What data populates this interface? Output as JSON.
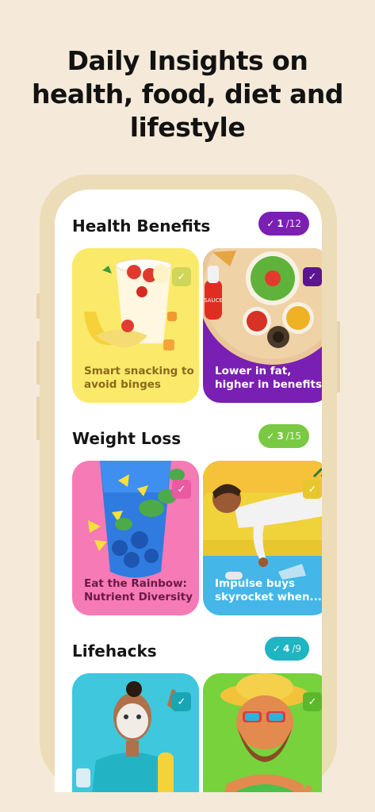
{
  "headline": {
    "line1": "Daily Insights on",
    "line2": "health, food, diet and",
    "line3": "lifestyle"
  },
  "sections": [
    {
      "title": "Health Benefits",
      "badge": {
        "done": "1",
        "total": "/12",
        "color": "#7a1fb3"
      },
      "cards": [
        {
          "caption": "Smart snacking to avoid binges",
          "bg": "#fbe96a",
          "caption_color": "#8a6a1a",
          "icon": "banana-yogurt-cup-image"
        },
        {
          "caption": "Lower in fat, higher in benefits",
          "bg": "#7a1fb3",
          "caption_color": "#ffffff",
          "icon": "food-platter-image",
          "sauce_label": "SAUCE"
        }
      ]
    },
    {
      "title": "Weight Loss",
      "badge": {
        "done": "3",
        "total": "/15",
        "color": "#7ac943"
      },
      "cards": [
        {
          "caption": "Eat the Rainbow: Nutrient Diversity",
          "bg": "#f57ab5",
          "caption_color": "#6b1a45",
          "icon": "blue-smoothie-glass-image"
        },
        {
          "caption": "Impulse buys skyrocket when...",
          "bg": "#45b6e8",
          "caption_color": "#ffffff",
          "icon": "person-sleeping-on-couch-image"
        }
      ]
    },
    {
      "title": "Lifehacks",
      "badge": {
        "done": "4",
        "total": "/9",
        "color": "#1fb5c2"
      },
      "cards": [
        {
          "caption": "",
          "bg": "#3ec7dd",
          "caption_color": "#ffffff",
          "icon": "man-face-mask-image"
        },
        {
          "caption": "",
          "bg": "#78d23c",
          "caption_color": "#ffffff",
          "icon": "bearded-man-sunglasses-image"
        }
      ]
    }
  ]
}
